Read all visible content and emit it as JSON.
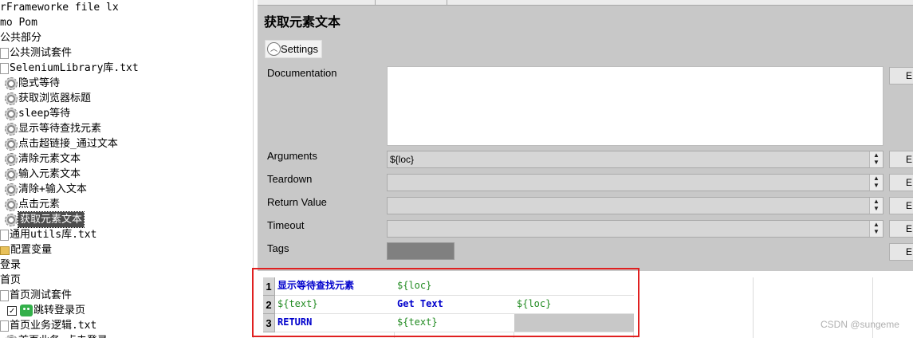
{
  "tree": {
    "items": [
      {
        "label": "rFrameworke file lx",
        "icon": "none",
        "indent": 0
      },
      {
        "label": "mo Pom",
        "icon": "none",
        "indent": 0
      },
      {
        "label": "公共部分",
        "icon": "none",
        "indent": 0
      },
      {
        "label": "公共测试套件",
        "icon": "file",
        "indent": 1
      },
      {
        "label": "SeleniumLibrary库.txt",
        "icon": "file",
        "indent": 1
      },
      {
        "label": "隐式等待",
        "icon": "gear",
        "indent": 2
      },
      {
        "label": "获取浏览器标题",
        "icon": "gear",
        "indent": 2
      },
      {
        "label": "sleep等待",
        "icon": "gear",
        "indent": 2
      },
      {
        "label": "显示等待查找元素",
        "icon": "gear",
        "indent": 2
      },
      {
        "label": "点击超链接_通过文本",
        "icon": "gear",
        "indent": 2
      },
      {
        "label": "清除元素文本",
        "icon": "gear",
        "indent": 2
      },
      {
        "label": "输入元素文本",
        "icon": "gear",
        "indent": 2
      },
      {
        "label": "清除+输入文本",
        "icon": "gear",
        "indent": 2
      },
      {
        "label": "点击元素",
        "icon": "gear",
        "indent": 2
      },
      {
        "label": "获取元素文本",
        "icon": "gear",
        "indent": 2,
        "selected": true
      },
      {
        "label": "通用utils库.txt",
        "icon": "file",
        "indent": 1
      },
      {
        "label": "配置变量",
        "icon": "folder",
        "indent": 1
      },
      {
        "label": "登录",
        "icon": "none",
        "indent": 0
      },
      {
        "label": "首页",
        "icon": "none",
        "indent": 0
      },
      {
        "label": "首页测试套件",
        "icon": "file",
        "indent": 1
      },
      {
        "label": "跳转登录页",
        "icon": "check-robot",
        "indent": 1
      },
      {
        "label": "首页业务逻辑.txt",
        "icon": "file",
        "indent": 1
      },
      {
        "label": "首页业务_点击登录",
        "icon": "gear",
        "indent": 2
      }
    ]
  },
  "editor": {
    "title": "获取元素文本",
    "settings_label": "Settings",
    "edit_label": "E",
    "fields": {
      "documentation": {
        "label": "Documentation",
        "value": ""
      },
      "arguments": {
        "label": "Arguments",
        "value": "${loc}"
      },
      "teardown": {
        "label": "Teardown",
        "value": ""
      },
      "return_value": {
        "label": "Return Value",
        "value": ""
      },
      "timeout": {
        "label": "Timeout",
        "value": ""
      },
      "tags": {
        "label": "Tags"
      }
    }
  },
  "grid": {
    "rows": [
      {
        "num": "1",
        "cells": [
          "显示等待查找元素",
          "${loc}",
          ""
        ]
      },
      {
        "num": "2",
        "cells": [
          "${text}",
          "Get Text",
          "${loc}"
        ]
      },
      {
        "num": "3",
        "cells": [
          "RETURN",
          "${text}",
          ""
        ]
      }
    ]
  },
  "watermark": "CSDN @sungeme",
  "colors": {
    "keyword": "#0000cc",
    "variable": "#228b22",
    "highlight": "#e02020",
    "panel": "#c8c8c8"
  }
}
